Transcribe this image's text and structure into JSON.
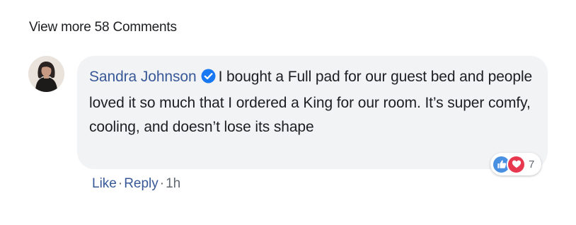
{
  "view_more": {
    "label": "View more 58 Comments"
  },
  "comment": {
    "author": "Sandra Johnson",
    "text": "I bought a Full pad for our guest bed and people loved it so much that I ordered a King for our room. It’s super comfy, cooling, and doesn’t lose its shape",
    "reactions": {
      "icons": [
        "like-icon",
        "love-icon"
      ],
      "count": "7"
    },
    "actions": {
      "like_label": "Like",
      "reply_label": "Reply",
      "separator": "·",
      "timestamp": "1h"
    }
  },
  "colors": {
    "link": "#385898",
    "bubble_bg": "#f2f3f5",
    "like_blue": "#4a90e2",
    "love_red": "#e8384f",
    "verified_blue": "#1877f2"
  }
}
